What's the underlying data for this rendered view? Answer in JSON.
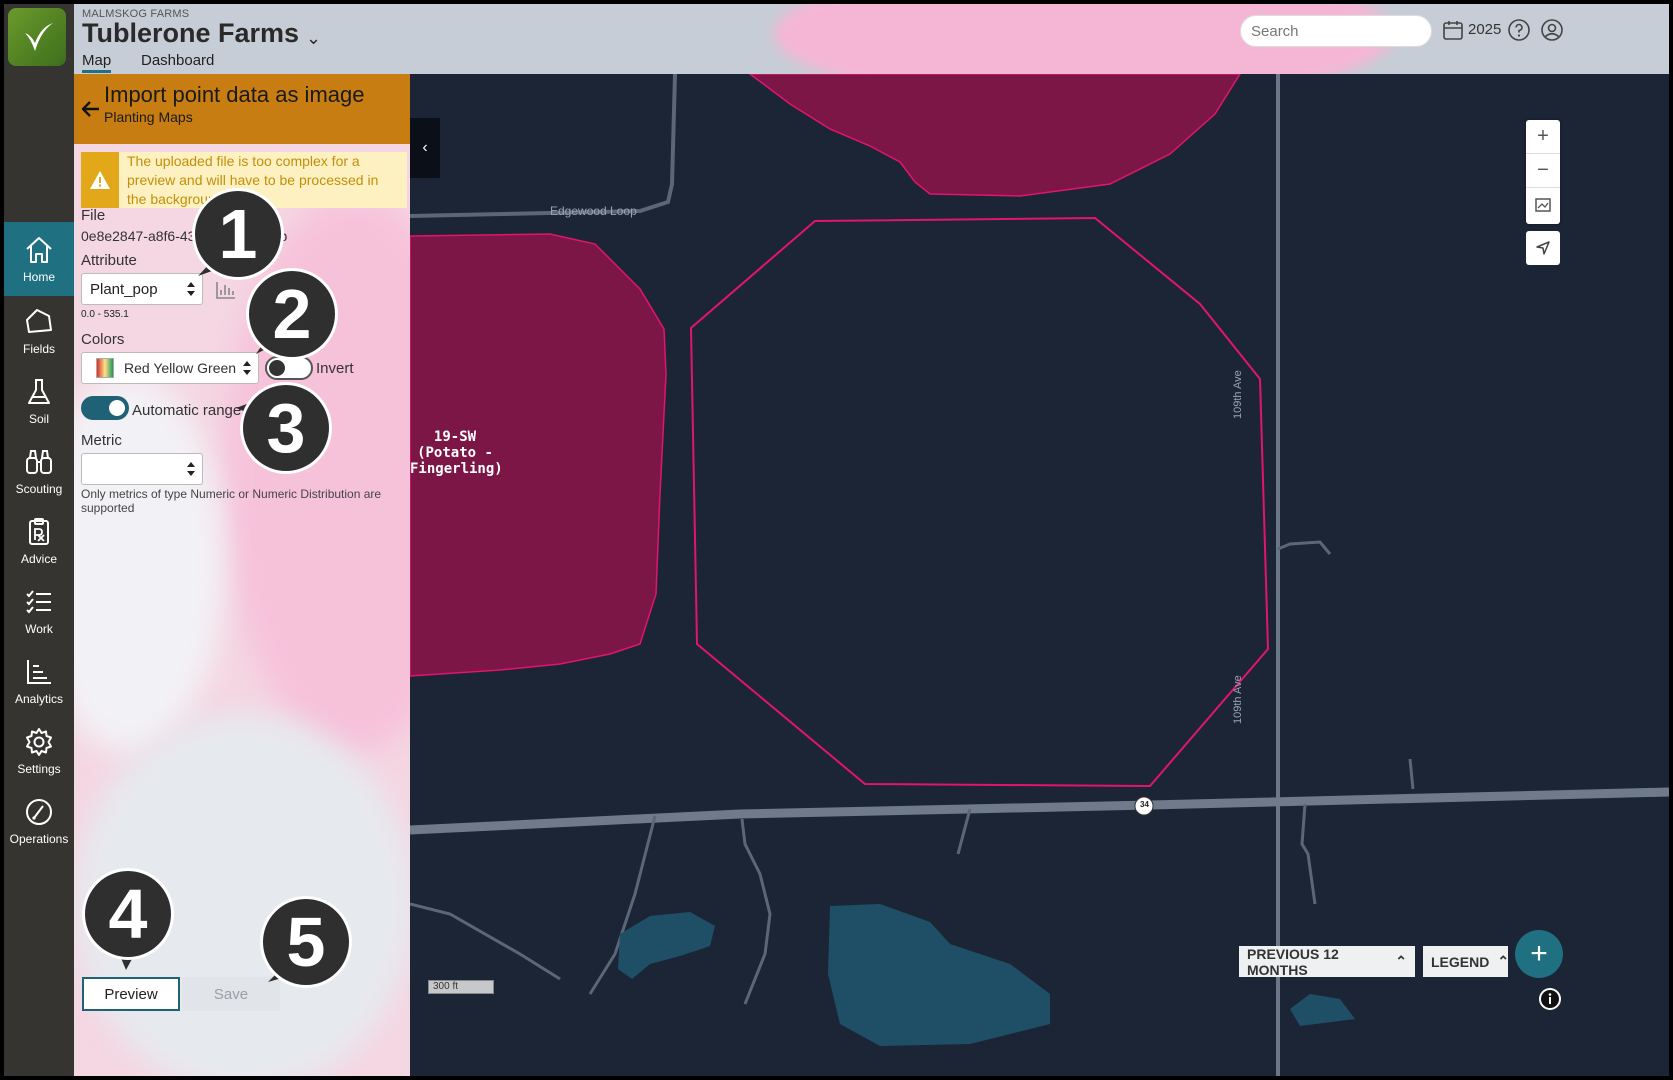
{
  "header": {
    "org_name": "MALMSKOG FARMS",
    "farm_title": "Tublerone Farms",
    "tabs": [
      "Map",
      "Dashboard"
    ],
    "search_placeholder": "Search",
    "year": "2025"
  },
  "nav": {
    "items": [
      {
        "label": "Home",
        "icon": "home-icon",
        "active": true
      },
      {
        "label": "Fields",
        "icon": "fields-icon"
      },
      {
        "label": "Soil",
        "icon": "flask-icon"
      },
      {
        "label": "Scouting",
        "icon": "binoculars-icon"
      },
      {
        "label": "Advice",
        "icon": "prescription-icon"
      },
      {
        "label": "Work",
        "icon": "checklist-icon"
      },
      {
        "label": "Analytics",
        "icon": "chart-icon"
      },
      {
        "label": "Settings",
        "icon": "gear-icon"
      },
      {
        "label": "Operations",
        "icon": "gauge-icon"
      }
    ]
  },
  "panel": {
    "title": "Import point data as image",
    "subtitle": "Planting Maps",
    "warning": "The uploaded file is too complex for a preview and will have to be processed in the background.",
    "file_label": "File",
    "file_name": "0e8e2847-a8f6-43...a64d84ef.zip",
    "attribute_label": "Attribute",
    "attribute_value": "Plant_pop",
    "range_text": "0.0 - 535.1",
    "colors_label": "Colors",
    "colors_value": "Red Yellow Green",
    "invert_label": "Invert",
    "invert_on": false,
    "auto_range_label": "Automatic range",
    "auto_range_on": true,
    "metric_label": "Metric",
    "metric_value": "",
    "metric_help": "Only metrics of type Numeric or Numeric Distribution are supported",
    "preview_label": "Preview",
    "save_label": "Save"
  },
  "map": {
    "field_label_1": "19-SW",
    "field_label_2": "(Potato -",
    "field_label_3": "Fingerling)",
    "road_edgewood": "Edgewood Loop",
    "road_109th": "109th Ave",
    "route_marker": "34",
    "scale": "300 ft",
    "prev_button": "PREVIOUS 12 MONTHS",
    "legend_button": "LEGEND"
  },
  "callouts": [
    "1",
    "2",
    "3",
    "4",
    "5"
  ],
  "colors": {
    "accent": "#1f7182",
    "panel_header": "#c77d12",
    "field_fill": "#7c1646",
    "field_stroke": "#e0156b",
    "map_bg": "#1c2536",
    "water": "#1f4f66"
  }
}
